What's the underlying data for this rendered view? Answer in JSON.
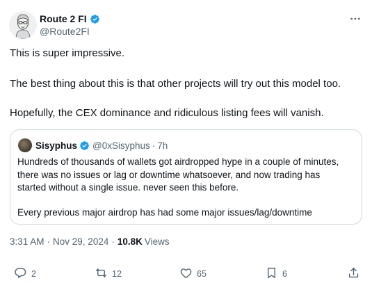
{
  "author": {
    "display_name": "Route 2 FI",
    "handle": "@Route2FI",
    "verified": true
  },
  "tweet": {
    "paragraphs": [
      "This is super impressive.",
      "The best thing about this is that other projects will try out this model too.",
      "Hopefully, the CEX dominance and ridiculous listing fees will vanish."
    ]
  },
  "quote": {
    "display_name": "Sisyphus",
    "handle": "@0xSisyphus",
    "separator": "·",
    "time": "7h",
    "lines": [
      "Hundreds of thousands of wallets got airdropped hype in a couple of minutes,",
      "there was no issues or lag or downtime whatsoever, and now trading has",
      "started without a single issue. never seen this before."
    ],
    "last_line": "Every previous major airdrop has had some major issues/lag/downtime"
  },
  "meta": {
    "time": "3:31 AM",
    "separator": "·",
    "date": "Nov 29, 2024",
    "views_count": "10.8K",
    "views_label": "Views"
  },
  "actions": {
    "reply_count": "2",
    "retweet_count": "12",
    "like_count": "65",
    "bookmark_count": "6"
  },
  "colors": {
    "verified": "#1d9bf0",
    "text_primary": "#0f1419",
    "text_secondary": "#536471",
    "border": "#cfd9de"
  },
  "icons": {
    "more": "more-dots-icon",
    "reply": "reply-icon",
    "retweet": "retweet-icon",
    "like": "heart-icon",
    "bookmark": "bookmark-icon",
    "share": "share-icon",
    "verified": "verified-badge-icon"
  }
}
